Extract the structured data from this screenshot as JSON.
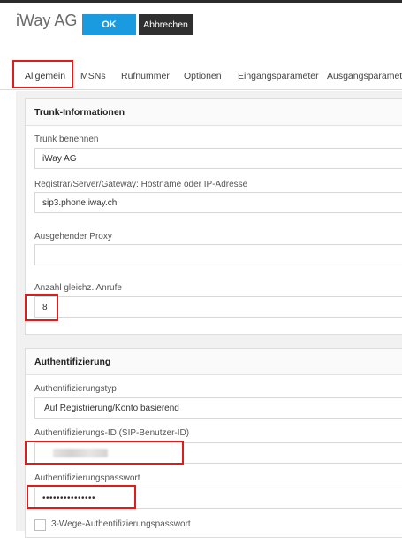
{
  "header": {
    "title": "iWay AG",
    "ok_label": "OK",
    "cancel_label": "Abbrechen"
  },
  "tabs": [
    {
      "label": "Allgemein"
    },
    {
      "label": "MSNs"
    },
    {
      "label": "Rufnummer"
    },
    {
      "label": "Optionen"
    },
    {
      "label": "Eingangsparameter"
    },
    {
      "label": "Ausgangsparameter"
    }
  ],
  "trunk": {
    "section_title": "Trunk-Informationen",
    "name_label": "Trunk benennen",
    "name_value": "iWay AG",
    "registrar_label": "Registrar/Server/Gateway: Hostname oder IP-Adresse",
    "registrar_value": "sip3.phone.iway.ch",
    "proxy_label": "Ausgehender Proxy",
    "proxy_value": "",
    "calls_label": "Anzahl gleichz. Anrufe",
    "calls_value": "8"
  },
  "auth": {
    "section_title": "Authentifizierung",
    "type_label": "Authentifizierungstyp",
    "type_value": "Auf Registrierung/Konto basierend",
    "id_label": "Authentifizierungs-ID (SIP-Benutzer-ID)",
    "password_label": "Authentifizierungspasswort",
    "password_value": "•••••••••••••••",
    "threeway_label": "3-Wege-Authentifizierungspasswort"
  },
  "colors": {
    "ok_button": "#1a9be0",
    "cancel_button": "#2f2f2f",
    "highlight": "#e01b1b"
  }
}
